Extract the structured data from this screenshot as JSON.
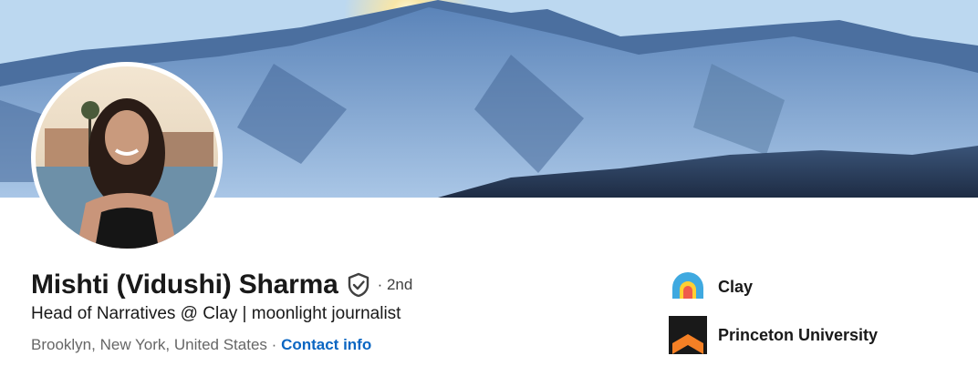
{
  "profile": {
    "name": "Mishti (Vidushi) Sharma",
    "degree": "· 2nd",
    "headline": "Head of Narratives @ Clay | moonlight journalist",
    "location": "Brooklyn, New York, United States",
    "separator": "·",
    "contact_label": "Contact info"
  },
  "organizations": [
    {
      "name": "Clay",
      "icon": "clay-logo-icon"
    },
    {
      "name": "Princeton University",
      "icon": "princeton-logo-icon"
    }
  ],
  "images": {
    "banner": "mountain-sunrise-banner",
    "avatar": "profile-photo"
  },
  "colors": {
    "link": "#0a66c2",
    "text_primary": "#191919",
    "text_secondary": "#666666",
    "princeton_orange": "#f58025",
    "clay_blue": "#3fa9e0"
  }
}
